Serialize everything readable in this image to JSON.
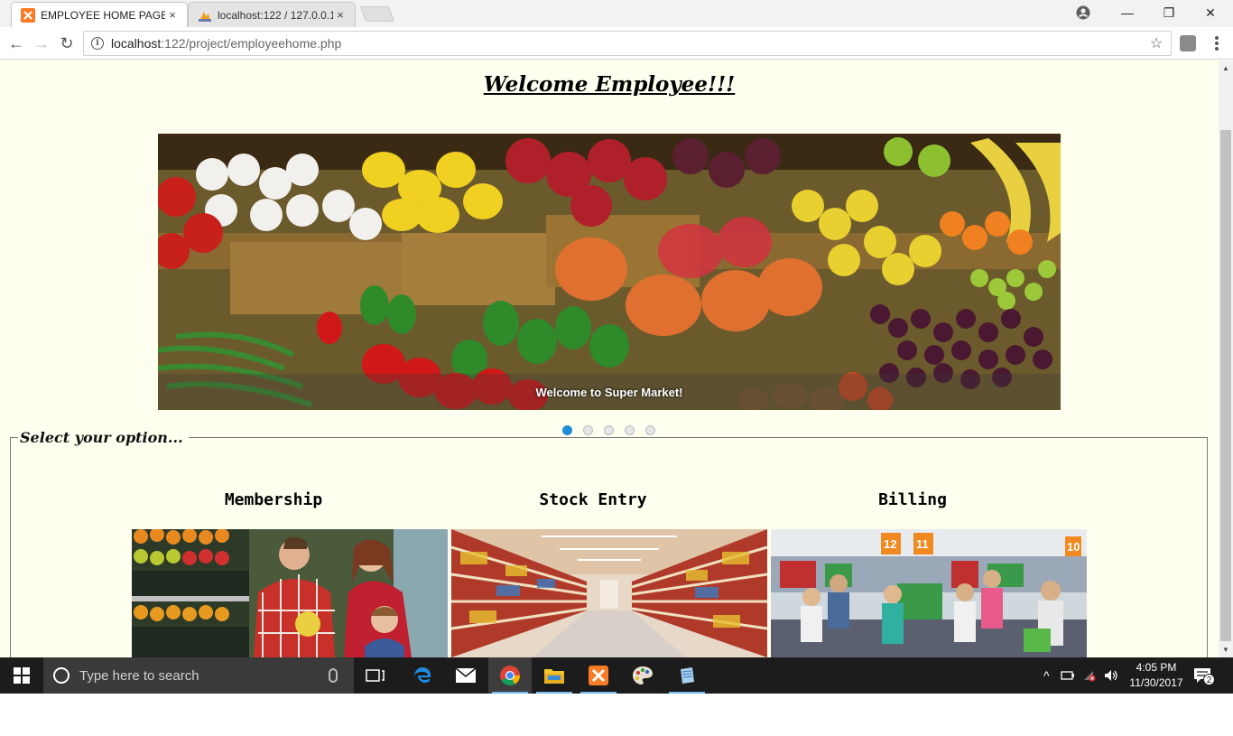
{
  "browser": {
    "tabs": [
      {
        "title": "EMPLOYEE HOME PAGE",
        "close": "×",
        "active": true,
        "icon": "xampp-favicon"
      },
      {
        "title": "localhost:122 / 127.0.0.1",
        "close": "×",
        "active": false,
        "icon": "phpmyadmin-favicon"
      }
    ],
    "window_controls": {
      "minimize": "—",
      "restore": "❐",
      "close": "✕"
    },
    "nav": {
      "back": "←",
      "forward": "→",
      "reload": "↻"
    },
    "address": {
      "host": "localhost",
      "rest": ":122/project/employeehome.php",
      "star": "☆"
    }
  },
  "page": {
    "welcome": "Welcome Employee!!!",
    "slider": {
      "caption": "Welcome to Super Market!",
      "slide_count": 5,
      "active_slide": 1
    },
    "options": {
      "legend": "Select your option...",
      "items": [
        {
          "title": "Membership",
          "image": "family-shopping-produce-photo"
        },
        {
          "title": "Stock Entry",
          "image": "supermarket-aisle-photo"
        },
        {
          "title": "Billing",
          "image": "checkout-counter-photo"
        }
      ]
    }
  },
  "taskbar": {
    "search_placeholder": "Type here to search",
    "time": "4:05 PM",
    "date": "11/30/2017",
    "notification_count": "2",
    "tray_arrow": "^"
  },
  "colors": {
    "page_background": "#fffff0",
    "active_dot": "#1e8fd6",
    "taskbar": "#1c1c1c"
  }
}
